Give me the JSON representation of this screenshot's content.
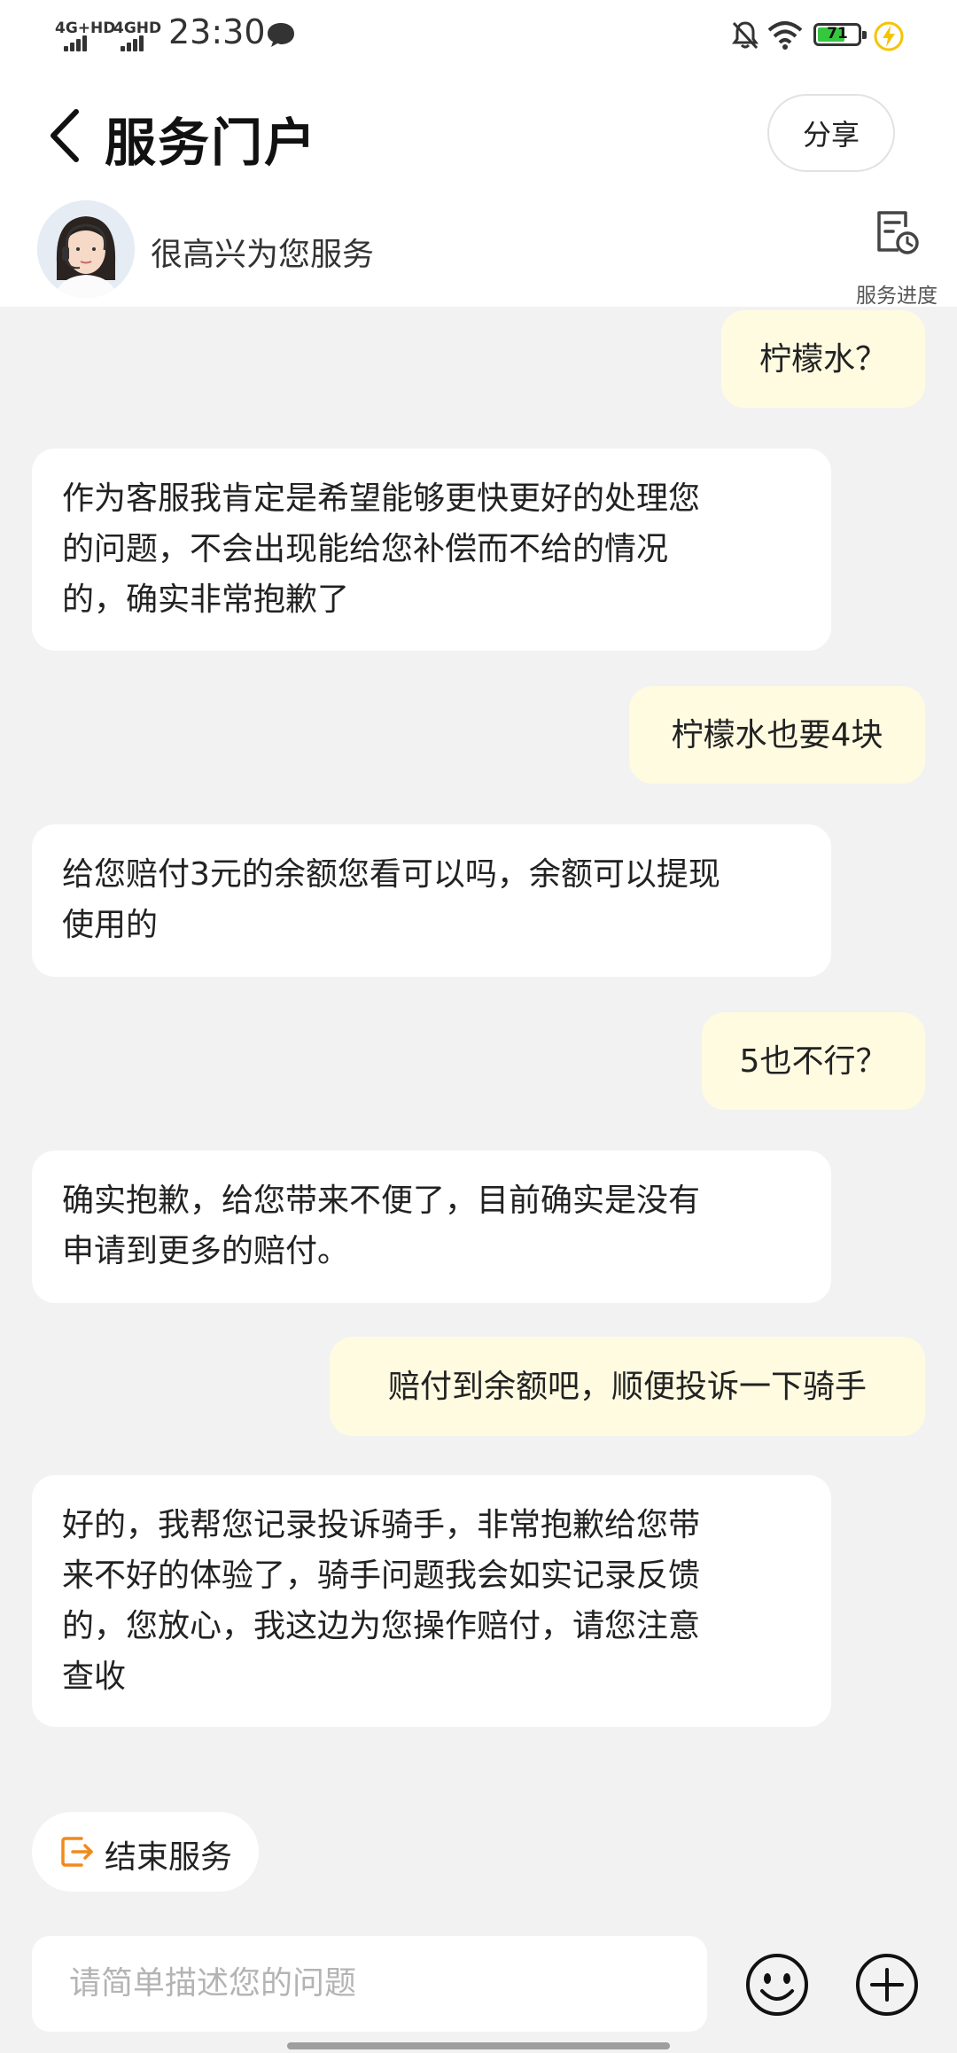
{
  "status_bar": {
    "network_1": "4G+HD",
    "network_2": "4GHD",
    "time": "23:30",
    "battery_level": "71",
    "battery_percent": 71,
    "battery_color": "#35c83f",
    "charge_color": "#f5c400",
    "icons": [
      "message-bubble-icon",
      "bell-off-icon",
      "wifi-icon",
      "battery-icon",
      "charging-icon"
    ]
  },
  "header": {
    "title": "服务门户",
    "share_label": "分享",
    "icons": [
      "back-chevron-icon"
    ]
  },
  "agent_bar": {
    "greeting": "很高兴为您服务",
    "progress_label": "服务进度",
    "icons": [
      "agent-avatar",
      "service-progress-icon"
    ]
  },
  "messages": [
    {
      "sender": "user",
      "text": "柠檬水？"
    },
    {
      "sender": "agent",
      "lines": [
        "作为客服我肯定是希望能够更快更好的处理您",
        "的问题，不会出现能给您补偿而不给的情况",
        "的，确实非常抱歉了"
      ]
    },
    {
      "sender": "user",
      "text": "柠檬水也要4块"
    },
    {
      "sender": "agent",
      "lines": [
        "给您赔付3元的余额您看可以吗，余额可以提现",
        "使用的"
      ]
    },
    {
      "sender": "user",
      "text": "5也不行？"
    },
    {
      "sender": "agent",
      "lines": [
        "确实抱歉，给您带来不便了，目前确实是没有",
        "申请到更多的赔付。"
      ]
    },
    {
      "sender": "user",
      "text": "赔付到余额吧，顺便投诉一下骑手"
    },
    {
      "sender": "agent",
      "lines": [
        "好的，我帮您记录投诉骑手，非常抱歉给您带",
        "来不好的体验了，骑手问题我会如实记录反馈",
        "的，您放心，我这边为您操作赔付，请您注意",
        "查收"
      ]
    }
  ],
  "bottom": {
    "end_service_label": "结束服务",
    "input_placeholder": "请简单描述您的问题",
    "accent_color": "#f08a1c",
    "icons": [
      "end-service-icon",
      "emoji-icon",
      "plus-icon"
    ]
  }
}
